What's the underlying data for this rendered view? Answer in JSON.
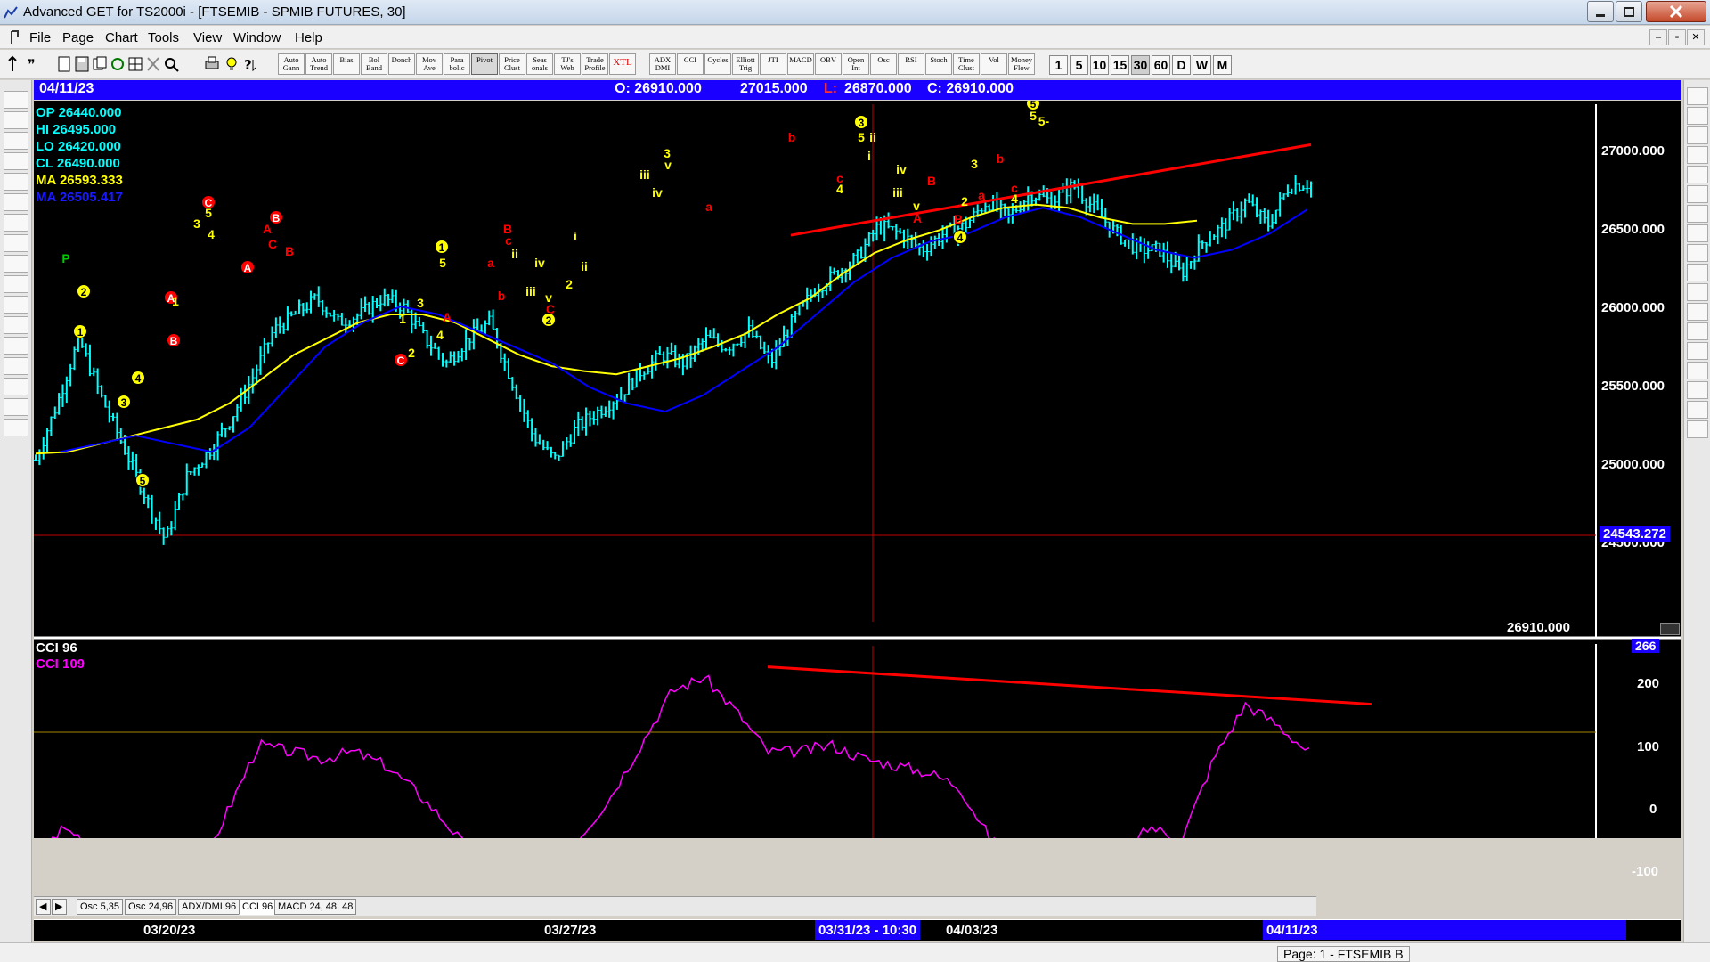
{
  "window": {
    "title": "Advanced GET for TS2000i - [FTSEMIB - SPMIB FUTURES, 30]"
  },
  "menu": {
    "items": [
      "File",
      "Page",
      "Chart",
      "Tools",
      "View",
      "Window",
      "Help"
    ]
  },
  "toolbar": {
    "study_buttons": [
      "Auto Gann",
      "Auto Trend",
      "Bias",
      "Bol Band",
      "Donch",
      "Mov Ave",
      "Para bolic",
      "Pivot",
      "Price Clust",
      "Seas onals",
      "TJ's Web",
      "Trade Profile",
      "XTL",
      "ADX DMI",
      "CCI",
      "Cycles",
      "Elliott Trig",
      "JTI",
      "MACD",
      "OBV",
      "Open Int",
      "Osc",
      "RSI",
      "Stoch",
      "Time Clust",
      "Vol",
      "Money Flow"
    ],
    "timeframes": [
      "1",
      "5",
      "10",
      "15",
      "30",
      "60",
      "D",
      "W",
      "M"
    ],
    "active_timeframe": "30"
  },
  "header": {
    "date": "04/11/23",
    "open": "O: 26910.000",
    "high": "27015.000",
    "low_label": "L:",
    "low": "26870.000",
    "close": "C: 26910.000"
  },
  "readout": {
    "op": "OP  26440.000",
    "hi": "HI   26495.000",
    "lo": "LO  26420.000",
    "cl": "CL  26490.000",
    "ma1": "MA  26593.333",
    "ma2": "MA  26505.417"
  },
  "price_axis": {
    "ticks": [
      "27000.000",
      "26500.000",
      "26000.000",
      "25500.000",
      "25000.000",
      "24500.000"
    ],
    "cursor_value": "24543.272",
    "last_value": "26910.000"
  },
  "cci_panel": {
    "title": "CCI 96",
    "value": "CCI  109",
    "ticks": [
      "200",
      "100",
      "0",
      "-100"
    ],
    "top_value": "266"
  },
  "tabs": [
    "Osc 5,35",
    "Osc 24,96",
    "ADX/DMI 96",
    "CCI 96",
    "MACD 24, 48, 48"
  ],
  "active_tab": "CCI 96",
  "dates": {
    "labels": [
      "03/20/23",
      "03/27/23",
      "04/03/23",
      "04/11/23"
    ],
    "cursor": "03/31/23 - 10:30"
  },
  "status": {
    "page": "Page: 1 - FTSEMIB B"
  },
  "colors": {
    "price_bars": "#00ffff",
    "ma_fast": "#ffff00",
    "ma_slow": "#0000ff",
    "trendline": "#ff0000",
    "cci": "#ff00ff",
    "header_bg": "#1a00ff",
    "wave_yellow": "#ffff00",
    "wave_red": "#ff0000"
  },
  "chart_data": {
    "type": "line",
    "instrument": "FTSEMIB - SPMIB FUTURES",
    "interval": "30",
    "ylim": [
      24200,
      27400
    ],
    "price_path": [
      25200,
      25550,
      25950,
      25600,
      25300,
      25000,
      24700,
      25100,
      25250,
      25450,
      25700,
      26000,
      26100,
      26200,
      26050,
      26100,
      26200,
      26150,
      25950,
      25800,
      25950,
      26050,
      25700,
      25350,
      25200,
      25400,
      25500,
      25600,
      25750,
      25850,
      25800,
      25950,
      25900,
      26000,
      25800,
      26050,
      26250,
      26350,
      26450,
      26650,
      26600,
      26500,
      26600,
      26650,
      26800,
      26700,
      26850,
      26800,
      26900,
      26750,
      26600,
      26500,
      26500,
      26350,
      26550,
      26650,
      26800,
      26650,
      26900,
      26910
    ],
    "ma_fast_path": [
      25240,
      25250,
      25300,
      25350,
      25400,
      25450,
      25550,
      25700,
      25850,
      25950,
      26050,
      26100,
      26100,
      26050,
      25950,
      25850,
      25780,
      25750,
      25730,
      25780,
      25830,
      25900,
      25980,
      26100,
      26200,
      26350,
      26480,
      26560,
      26620,
      26700,
      26760,
      26780,
      26760,
      26700,
      26660,
      26660,
      26680
    ],
    "ma_slow_path": [
      25250,
      25300,
      25350,
      25300,
      25250,
      25400,
      25650,
      25900,
      26050,
      26150,
      26100,
      26000,
      25900,
      25800,
      25650,
      25550,
      25500,
      25600,
      25750,
      25900,
      26100,
      26300,
      26450,
      26550,
      26600,
      26700,
      26760,
      26700,
      26600,
      26500,
      26450,
      26500,
      26600,
      26750
    ],
    "cci_path": [
      -40,
      0,
      -60,
      -110,
      -150,
      -80,
      20,
      120,
      110,
      100,
      110,
      90,
      50,
      0,
      -60,
      -40,
      -30,
      -20,
      40,
      120,
      200,
      220,
      170,
      110,
      110,
      120,
      100,
      90,
      80,
      60,
      -20,
      -60,
      -80,
      -120,
      -50,
      0,
      -20,
      100,
      180,
      150,
      109
    ],
    "cci_ylim": [
      -130,
      266
    ],
    "trendlines": [
      {
        "panel": "price",
        "from": [
          26590,
          "03/29"
        ],
        "to": [
          27150,
          "04/11"
        ]
      },
      {
        "panel": "cci",
        "from": [
          235,
          "03/28"
        ],
        "to": [
          180,
          "04/12"
        ]
      }
    ],
    "wave_labels": [
      "P",
      "1",
      "2",
      "3",
      "4",
      "5",
      "A",
      "B",
      "C",
      "a",
      "b",
      "c",
      "i",
      "ii",
      "iii",
      "iv",
      "v"
    ]
  }
}
